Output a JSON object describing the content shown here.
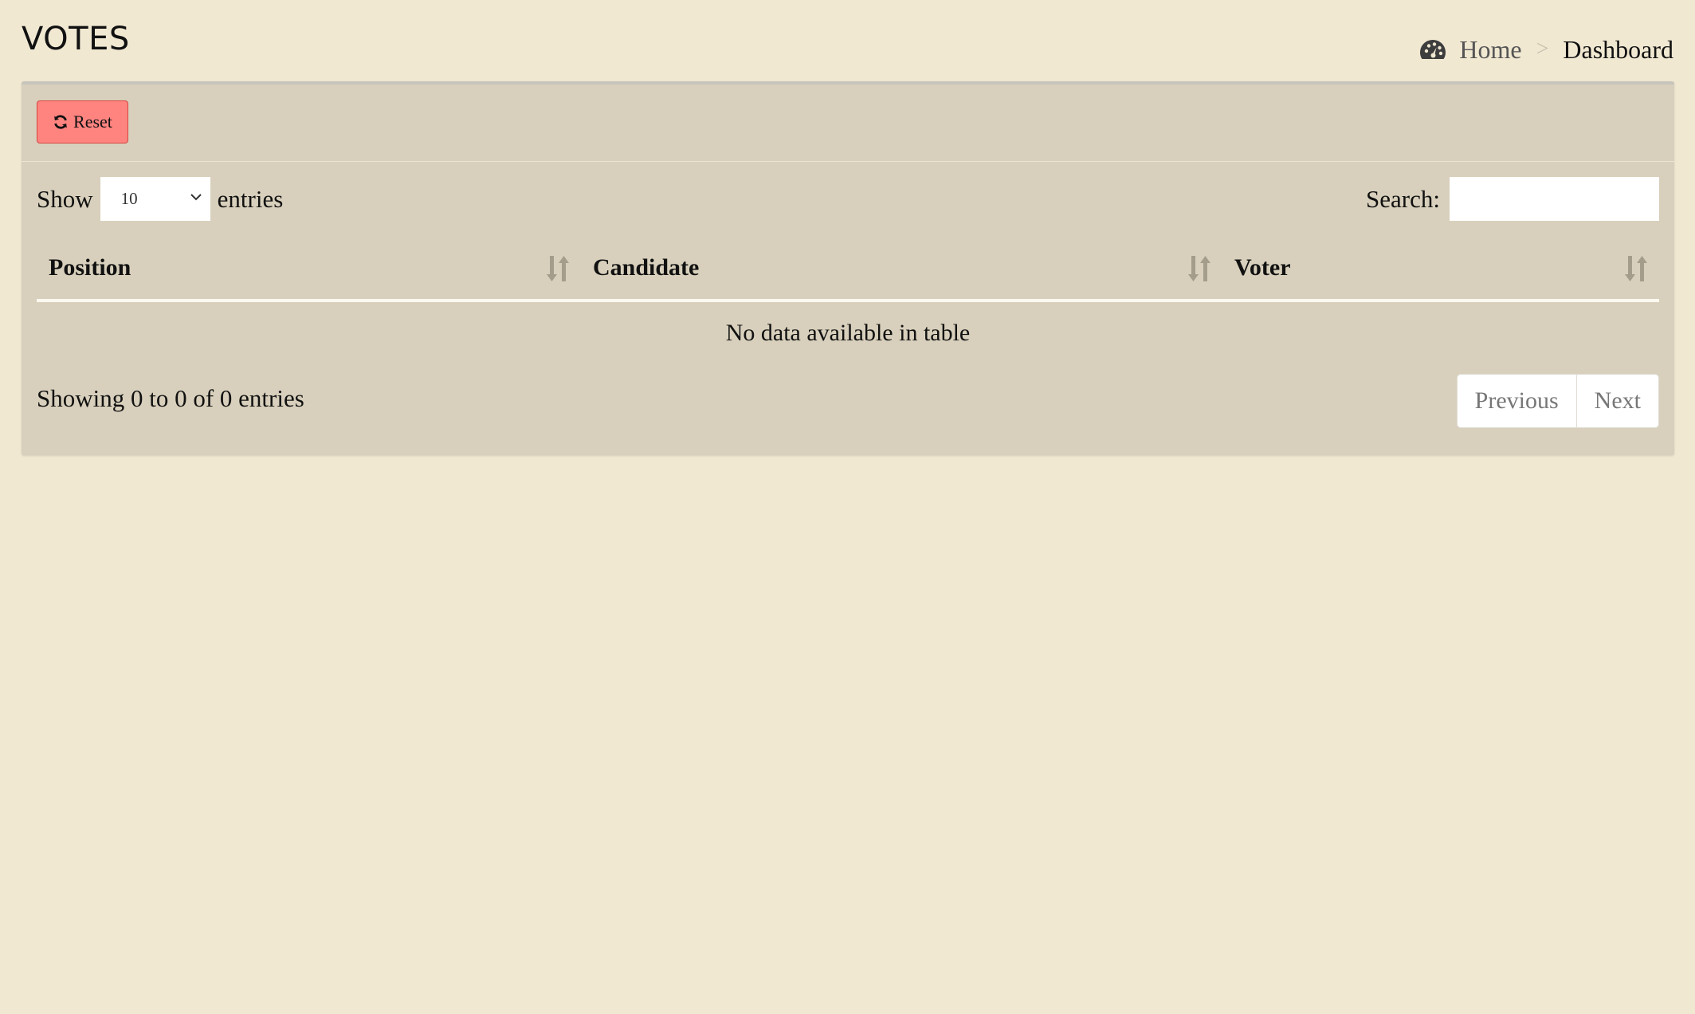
{
  "header": {
    "title": "VOTES",
    "breadcrumb": {
      "home_icon": "dashboard-gauge-icon",
      "home_label": "Home",
      "separator": ">",
      "current": "Dashboard"
    }
  },
  "toolbar": {
    "reset_icon": "refresh-icon",
    "reset_label": "Reset",
    "reset_color": "#ff8480"
  },
  "table_controls": {
    "show_label": "Show",
    "page_length": "10",
    "entries_label": "entries",
    "search_label": "Search:",
    "search_value": ""
  },
  "table": {
    "columns": [
      {
        "label": "Position"
      },
      {
        "label": "Candidate"
      },
      {
        "label": "Voter"
      }
    ],
    "empty_message": "No data available in table"
  },
  "footer": {
    "info": "Showing 0 to 0 of 0 entries",
    "prev_label": "Previous",
    "next_label": "Next"
  }
}
